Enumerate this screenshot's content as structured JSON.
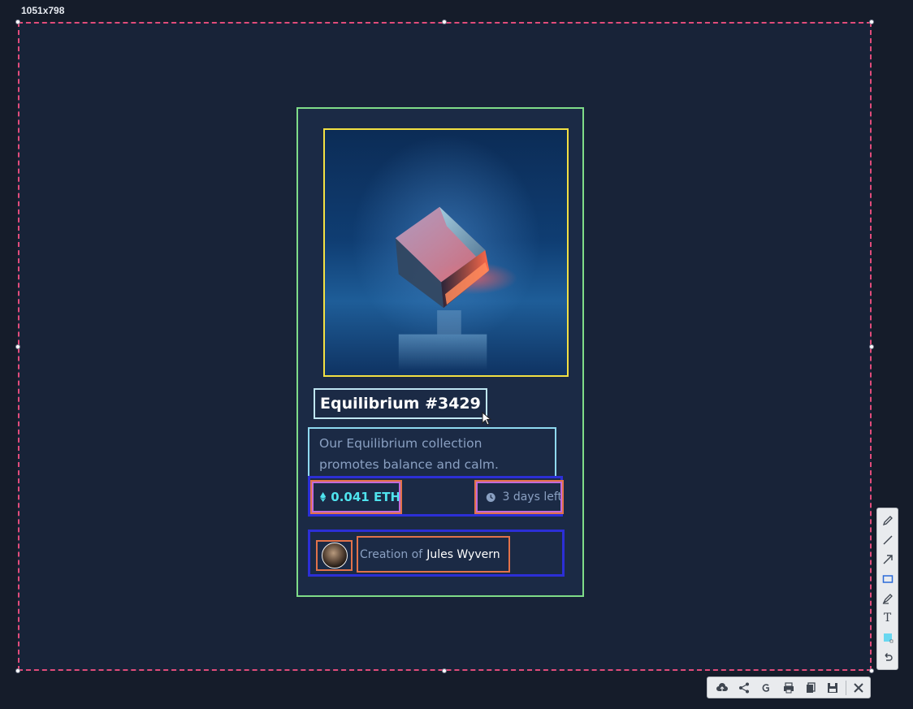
{
  "overlay": {
    "size_label": "1051x798"
  },
  "card": {
    "title": "Equilibrium #3429",
    "description": "Our Equilibrium collection promotes balance and calm.",
    "price": "0.041 ETH",
    "time_left": "3 days left",
    "creator_prefix": "Creation of",
    "creator_name": "Jules Wyvern",
    "image_icon": "crystal-cube-image",
    "avatar_icon": "avatar-icon"
  },
  "colors": {
    "background": "#182338",
    "card": "#1b2a45",
    "price_accent": "#4fe3ee",
    "muted_text": "#8aa0c2",
    "capture_border": "#e14c7a"
  },
  "draw_toolbar": {
    "tools": [
      "pen-icon",
      "line-icon",
      "arrow-icon",
      "rectangle-icon",
      "marker-icon",
      "text-icon",
      "color-swatch-icon",
      "undo-icon"
    ],
    "text_tool_glyph": "T"
  },
  "action_toolbar": {
    "actions": [
      "upload-cloud-icon",
      "share-icon",
      "google-search-icon",
      "print-icon",
      "copy-icon",
      "save-icon",
      "close-icon"
    ]
  }
}
